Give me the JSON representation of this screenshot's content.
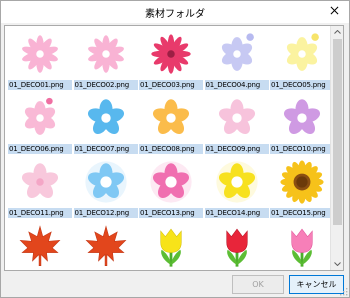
{
  "window": {
    "title": "素材フォルダ"
  },
  "tiles": [
    {
      "label": "01_DECO01.png",
      "icon": "flower-daisy-pink"
    },
    {
      "label": "01_DECO02.png",
      "icon": "flower-daisy-pink"
    },
    {
      "label": "01_DECO03.png",
      "icon": "flower-daisy-red"
    },
    {
      "label": "01_DECO04.png",
      "icon": "flower-lavender"
    },
    {
      "label": "01_DECO05.png",
      "icon": "flower-yellow"
    },
    {
      "label": "01_DECO06.png",
      "icon": "flower-pink-petals"
    },
    {
      "label": "01_DECO07.png",
      "icon": "flower-blue"
    },
    {
      "label": "01_DECO08.png",
      "icon": "flower-orange"
    },
    {
      "label": "01_DECO09.png",
      "icon": "flower-pale-pink"
    },
    {
      "label": "01_DECO10.png",
      "icon": "flower-purple"
    },
    {
      "label": "01_DECO11.png",
      "icon": "flower-sakura"
    },
    {
      "label": "01_DECO12.png",
      "icon": "flower-blue-glow"
    },
    {
      "label": "01_DECO13.png",
      "icon": "flower-pink-glow"
    },
    {
      "label": "01_DECO14.png",
      "icon": "flower-yellow-glow"
    },
    {
      "label": "01_DECO15.png",
      "icon": "sunflower"
    },
    {
      "label": "",
      "icon": "maple-leaf-red"
    },
    {
      "label": "",
      "icon": "maple-leaf-red"
    },
    {
      "label": "",
      "icon": "tulip-yellow"
    },
    {
      "label": "",
      "icon": "tulip-red"
    },
    {
      "label": "",
      "icon": "tulip-pink"
    }
  ],
  "buttons": {
    "ok": "OK",
    "cancel": "キャンセル"
  },
  "colors": {
    "caption_bg": "#c7dcf1",
    "cancel_border": "#0078d7"
  }
}
